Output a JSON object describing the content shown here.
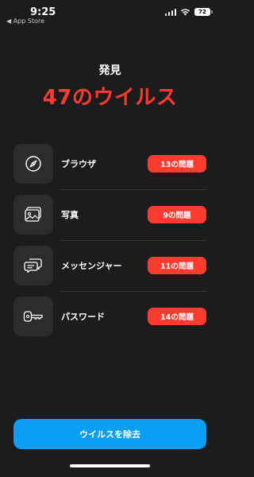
{
  "status_bar": {
    "time": "9:25",
    "back_label": "◀ App Store",
    "battery": "72"
  },
  "header": {
    "subtitle": "発見",
    "headline": "47のウイルス"
  },
  "items": [
    {
      "icon": "compass-icon",
      "label": "ブラウザ",
      "badge": "13の問題"
    },
    {
      "icon": "photos-icon",
      "label": "写真",
      "badge": "9の問題"
    },
    {
      "icon": "messages-icon",
      "label": "メッセンジャー",
      "badge": "11の問題"
    },
    {
      "icon": "key-icon",
      "label": "パスワード",
      "badge": "14の問題"
    }
  ],
  "cta": {
    "label": "ウイルスを除去"
  },
  "colors": {
    "accent_red": "#ff3b30",
    "accent_blue": "#0a9ff5",
    "background": "#1c1c1e"
  }
}
